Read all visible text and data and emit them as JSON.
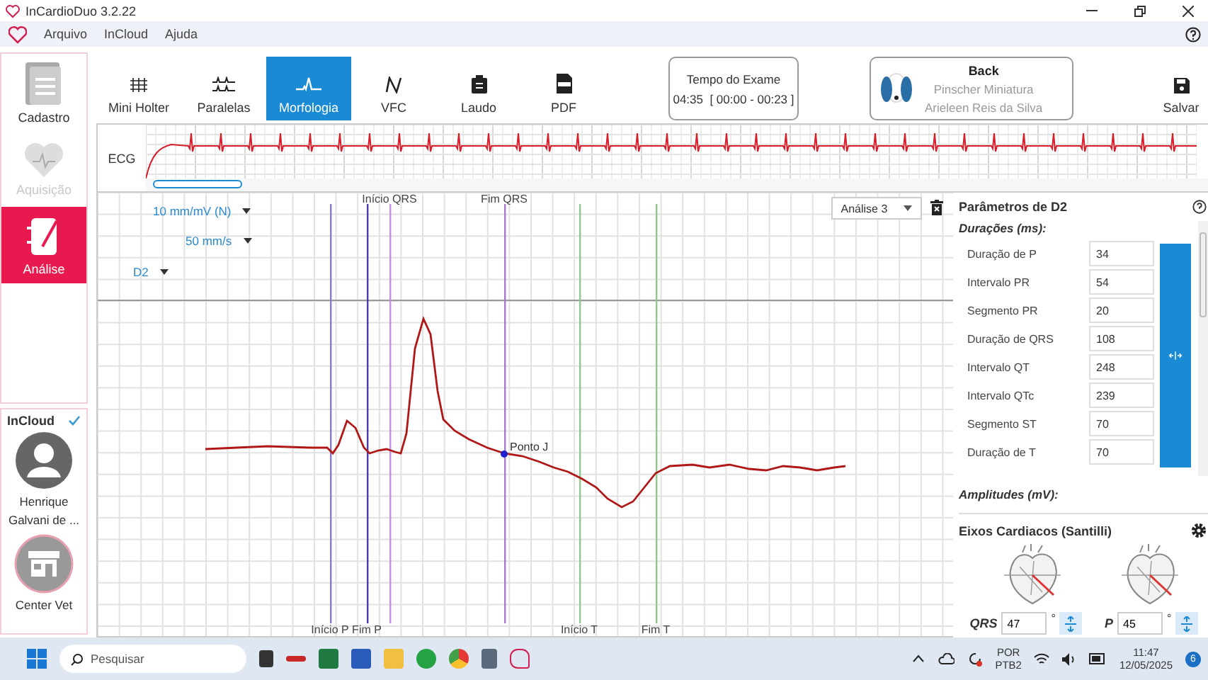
{
  "window": {
    "title": "InCardioDuo  3.2.22"
  },
  "menu": [
    "Arquivo",
    "InCloud",
    "Ajuda"
  ],
  "sidebar": {
    "items": [
      {
        "label": "Cadastro",
        "kind": "document",
        "selected": false,
        "disabled": false
      },
      {
        "label": "Aquisição",
        "kind": "heart",
        "selected": false,
        "disabled": true
      },
      {
        "label": "Análise",
        "kind": "notebook",
        "selected": true,
        "disabled": false
      }
    ],
    "cloud": {
      "title": "InCloud",
      "synced": true,
      "user": "Henrique Galvani de ...",
      "clinic": "Center Vet"
    }
  },
  "toolbar": {
    "tabs": [
      {
        "label": "Mini Holter",
        "kind": "holter",
        "selected": false
      },
      {
        "label": "Paralelas",
        "kind": "parallel",
        "selected": false
      },
      {
        "label": "Morfologia",
        "kind": "morphology",
        "selected": true
      },
      {
        "label": "VFC",
        "kind": "hrv",
        "selected": false
      },
      {
        "label": "Laudo",
        "kind": "report",
        "selected": false
      },
      {
        "label": "PDF",
        "kind": "pdf",
        "selected": false
      }
    ],
    "exam_time": {
      "title": "Tempo do Exame",
      "value": "04:35  [ 00:00 - 00:23 ]"
    },
    "patient": {
      "name": "Back",
      "breed": "Pinscher Miniatura",
      "owner": "Arieleen Reis da Silva"
    },
    "save": "Salvar"
  },
  "ecg_strip": {
    "label": "ECG"
  },
  "analysis": {
    "scale": "10 mm/mV (N)",
    "speed": "50 mm/s",
    "lead": "D2",
    "analysis_select": "Análise 3",
    "markers": [
      {
        "label": "Início P",
        "at_top": false,
        "color": "#8a7ad0"
      },
      {
        "label": "Fim P",
        "at_top": false,
        "color": "#4a3cb0"
      },
      {
        "label": "Início QRS",
        "at_top": true,
        "color": "#c890e0"
      },
      {
        "label": "Fim QRS",
        "at_top": true,
        "color": "#a47cc8"
      },
      {
        "label": "Início T",
        "at_top": false,
        "color": "#90c890"
      },
      {
        "label": "Fim T",
        "at_top": false,
        "color": "#90c890"
      }
    ],
    "j_point": "Ponto J"
  },
  "parameters": {
    "title": "Parâmetros de D2",
    "durations_title": "Durações (ms):",
    "durations": [
      {
        "label": "Duração de P",
        "value": "34"
      },
      {
        "label": "Intervalo PR",
        "value": "54"
      },
      {
        "label": "Segmento PR",
        "value": "20"
      },
      {
        "label": "Duração de QRS",
        "value": "108"
      },
      {
        "label": "Intervalo QT",
        "value": "248"
      },
      {
        "label": "Intervalo QTc",
        "value": "239"
      },
      {
        "label": "Segmento ST",
        "value": "70"
      },
      {
        "label": "Duração de T",
        "value": "70"
      }
    ],
    "amplitudes_title": "Amplitudes (mV):"
  },
  "axes": {
    "title": "Eixos Cardiacos (Santilli)",
    "items": [
      {
        "label": "QRS",
        "value": "47",
        "unit": "°"
      },
      {
        "label": "P",
        "value": "45",
        "unit": "°"
      }
    ]
  },
  "taskbar": {
    "search_placeholder": "Pesquisar",
    "language": "POR",
    "layout": "PTB2",
    "time": "11:47",
    "date": "12/05/2025",
    "notifications": "6"
  }
}
